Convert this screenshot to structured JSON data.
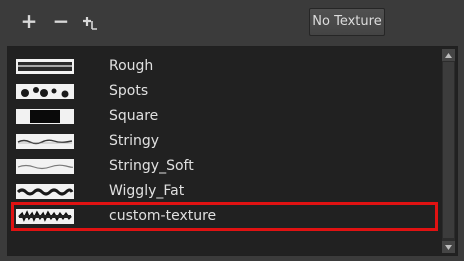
{
  "toolbar": {
    "add_label": "+",
    "remove_label": "−",
    "no_texture_label": "No Texture"
  },
  "textures": [
    {
      "label": "Rough",
      "icon": "rough-texture-swatch"
    },
    {
      "label": "Spots",
      "icon": "spots-texture-swatch"
    },
    {
      "label": "Square",
      "icon": "square-texture-swatch"
    },
    {
      "label": "Stringy",
      "icon": "stringy-texture-swatch"
    },
    {
      "label": "Stringy_Soft",
      "icon": "stringy-soft-texture-swatch"
    },
    {
      "label": "Wiggly_Fat",
      "icon": "wiggly-fat-texture-swatch"
    },
    {
      "label": "custom-texture",
      "icon": "custom-texture-swatch",
      "highlighted": true
    }
  ],
  "colors": {
    "highlight": "#e01212",
    "list_background": "#212121",
    "panel_background": "#3b3b3b"
  }
}
